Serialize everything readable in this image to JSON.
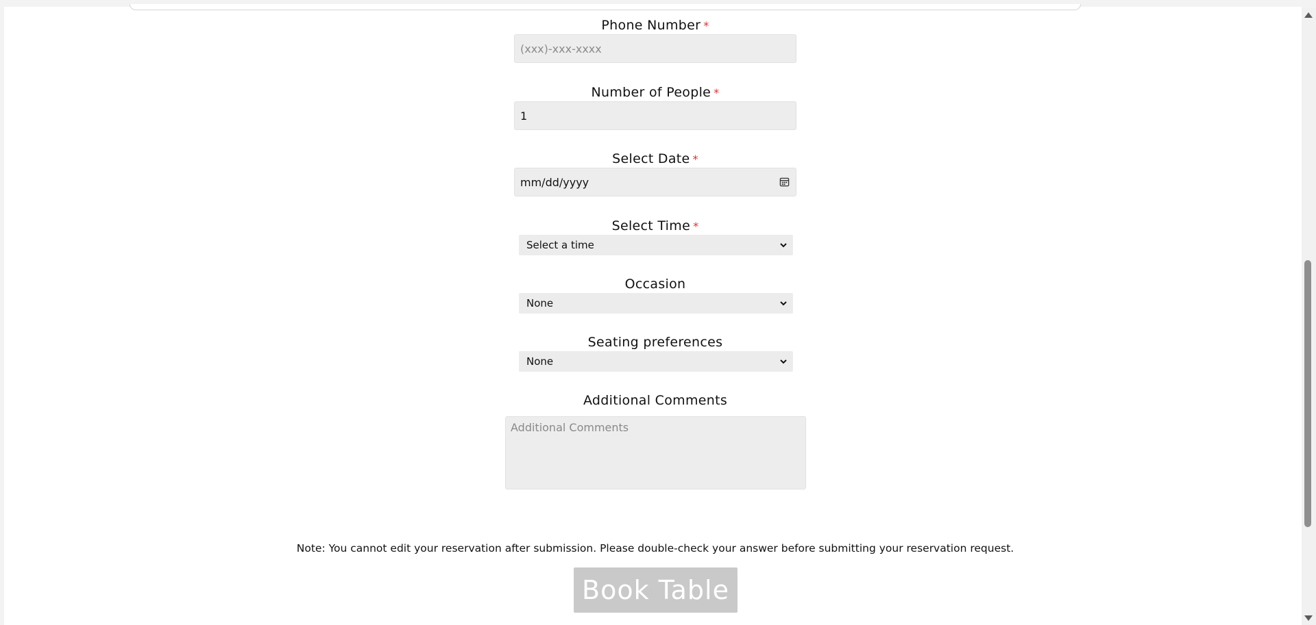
{
  "form": {
    "phone": {
      "label": "Phone Number",
      "required_mark": "*",
      "placeholder": "(xxx)-xxx-xxxx"
    },
    "people": {
      "label": "Number of People",
      "required_mark": "*",
      "value": "1"
    },
    "date": {
      "label": "Select Date",
      "required_mark": "*",
      "placeholder": "mm/dd/yyyy",
      "icon": "calendar-icon"
    },
    "time": {
      "label": "Select Time",
      "required_mark": "*",
      "selected": "Select a time"
    },
    "occasion": {
      "label": "Occasion",
      "selected": "None"
    },
    "seating": {
      "label": "Seating preferences",
      "selected": "None"
    },
    "comments": {
      "label": "Additional Comments",
      "placeholder": "Additional Comments"
    },
    "note": "Note: You cannot edit your reservation after submission. Please double-check your answer before submitting your reservation request.",
    "submit_label": "Book Table"
  },
  "colors": {
    "required": "#e03030",
    "input_bg": "#ededed",
    "button_bg": "#c9c9c9",
    "button_text": "#ffffff"
  }
}
